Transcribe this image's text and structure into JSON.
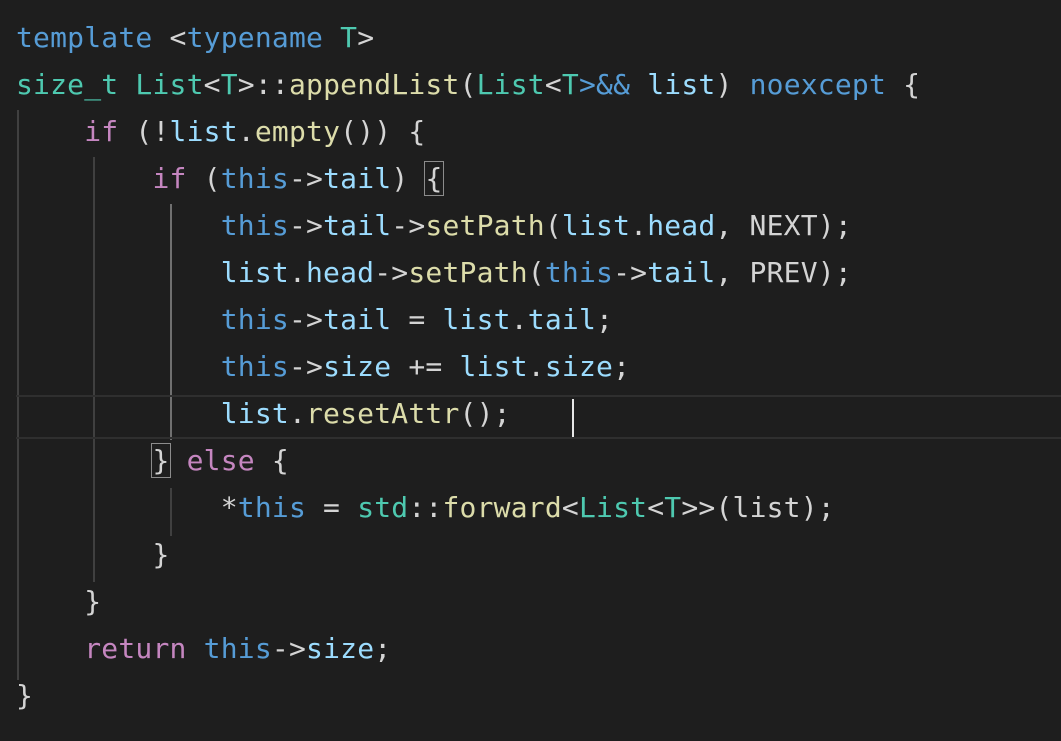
{
  "editor": {
    "background": "#1e1e1e",
    "colors": {
      "keyword": "#569cd6",
      "control": "#c586c0",
      "type": "#4ec9b0",
      "function": "#dcdcaa",
      "variable": "#9cdcfe",
      "plain": "#d4d4d4"
    },
    "lines": [
      [
        {
          "t": "template",
          "c": "kw"
        },
        {
          "t": " ",
          "c": "pl"
        },
        {
          "t": "<",
          "c": "op"
        },
        {
          "t": "typename",
          "c": "kw"
        },
        {
          "t": " ",
          "c": "pl"
        },
        {
          "t": "T",
          "c": "ty"
        },
        {
          "t": ">",
          "c": "op"
        }
      ],
      [
        {
          "t": "size_t",
          "c": "ty"
        },
        {
          "t": " ",
          "c": "pl"
        },
        {
          "t": "List",
          "c": "ty"
        },
        {
          "t": "<",
          "c": "op"
        },
        {
          "t": "T",
          "c": "ty"
        },
        {
          "t": ">::",
          "c": "op"
        },
        {
          "t": "appendList",
          "c": "fn"
        },
        {
          "t": "(",
          "c": "pl"
        },
        {
          "t": "List",
          "c": "ty"
        },
        {
          "t": "<",
          "c": "op"
        },
        {
          "t": "T",
          "c": "ty"
        },
        {
          "t": ">&&",
          "c": "kw"
        },
        {
          "t": " ",
          "c": "pl"
        },
        {
          "t": "list",
          "c": "var"
        },
        {
          "t": ")",
          "c": "pl"
        },
        {
          "t": " ",
          "c": "pl"
        },
        {
          "t": "noexcept",
          "c": "kw"
        },
        {
          "t": " ",
          "c": "pl"
        },
        {
          "t": "{",
          "c": "pl"
        }
      ],
      [
        {
          "t": "    ",
          "c": "pl"
        },
        {
          "t": "if",
          "c": "ctl"
        },
        {
          "t": " (",
          "c": "pl"
        },
        {
          "t": "!",
          "c": "op"
        },
        {
          "t": "list",
          "c": "var"
        },
        {
          "t": ".",
          "c": "pl"
        },
        {
          "t": "empty",
          "c": "fn"
        },
        {
          "t": "()) {",
          "c": "pl"
        }
      ],
      [
        {
          "t": "        ",
          "c": "pl"
        },
        {
          "t": "if",
          "c": "ctl"
        },
        {
          "t": " (",
          "c": "pl"
        },
        {
          "t": "this",
          "c": "kw"
        },
        {
          "t": "->",
          "c": "op"
        },
        {
          "t": "tail",
          "c": "var"
        },
        {
          "t": ") ",
          "c": "pl"
        },
        {
          "t": "{",
          "c": "pl",
          "box": true
        }
      ],
      [
        {
          "t": "            ",
          "c": "pl"
        },
        {
          "t": "this",
          "c": "kw"
        },
        {
          "t": "->",
          "c": "op"
        },
        {
          "t": "tail",
          "c": "var"
        },
        {
          "t": "->",
          "c": "op"
        },
        {
          "t": "setPath",
          "c": "fn"
        },
        {
          "t": "(",
          "c": "pl"
        },
        {
          "t": "list",
          "c": "var"
        },
        {
          "t": ".",
          "c": "pl"
        },
        {
          "t": "head",
          "c": "var"
        },
        {
          "t": ", NEXT);",
          "c": "pl"
        }
      ],
      [
        {
          "t": "            ",
          "c": "pl"
        },
        {
          "t": "list",
          "c": "var"
        },
        {
          "t": ".",
          "c": "pl"
        },
        {
          "t": "head",
          "c": "var"
        },
        {
          "t": "->",
          "c": "op"
        },
        {
          "t": "setPath",
          "c": "fn"
        },
        {
          "t": "(",
          "c": "pl"
        },
        {
          "t": "this",
          "c": "kw"
        },
        {
          "t": "->",
          "c": "op"
        },
        {
          "t": "tail",
          "c": "var"
        },
        {
          "t": ", PREV);",
          "c": "pl"
        }
      ],
      [
        {
          "t": "            ",
          "c": "pl"
        },
        {
          "t": "this",
          "c": "kw"
        },
        {
          "t": "->",
          "c": "op"
        },
        {
          "t": "tail",
          "c": "var"
        },
        {
          "t": " = ",
          "c": "op"
        },
        {
          "t": "list",
          "c": "var"
        },
        {
          "t": ".",
          "c": "pl"
        },
        {
          "t": "tail",
          "c": "var"
        },
        {
          "t": ";",
          "c": "pl"
        }
      ],
      [
        {
          "t": "            ",
          "c": "pl"
        },
        {
          "t": "this",
          "c": "kw"
        },
        {
          "t": "->",
          "c": "op"
        },
        {
          "t": "size",
          "c": "var"
        },
        {
          "t": " += ",
          "c": "op"
        },
        {
          "t": "list",
          "c": "var"
        },
        {
          "t": ".",
          "c": "pl"
        },
        {
          "t": "size",
          "c": "var"
        },
        {
          "t": ";",
          "c": "pl"
        }
      ],
      [
        {
          "t": "            ",
          "c": "pl"
        },
        {
          "t": "list",
          "c": "var"
        },
        {
          "t": ".",
          "c": "pl"
        },
        {
          "t": "resetAttr",
          "c": "fn"
        },
        {
          "t": "();",
          "c": "pl"
        }
      ],
      [
        {
          "t": "        ",
          "c": "pl"
        },
        {
          "t": "}",
          "c": "pl",
          "box": true
        },
        {
          "t": " ",
          "c": "pl"
        },
        {
          "t": "else",
          "c": "ctl"
        },
        {
          "t": " {",
          "c": "pl"
        }
      ],
      [
        {
          "t": "            ",
          "c": "pl"
        },
        {
          "t": "*",
          "c": "op"
        },
        {
          "t": "this",
          "c": "kw"
        },
        {
          "t": " = ",
          "c": "op"
        },
        {
          "t": "std",
          "c": "ty"
        },
        {
          "t": "::",
          "c": "pl"
        },
        {
          "t": "forward",
          "c": "fn"
        },
        {
          "t": "<",
          "c": "op"
        },
        {
          "t": "List",
          "c": "ty"
        },
        {
          "t": "<",
          "c": "op"
        },
        {
          "t": "T",
          "c": "ty"
        },
        {
          "t": ">>",
          "c": "op"
        },
        {
          "t": "(list);",
          "c": "pl"
        }
      ],
      [
        {
          "t": "        ",
          "c": "pl"
        },
        {
          "t": "}",
          "c": "pl"
        }
      ],
      [
        {
          "t": "    ",
          "c": "pl"
        },
        {
          "t": "}",
          "c": "pl"
        }
      ],
      [
        {
          "t": "    ",
          "c": "pl"
        },
        {
          "t": "return",
          "c": "ctl"
        },
        {
          "t": " ",
          "c": "pl"
        },
        {
          "t": "this",
          "c": "kw"
        },
        {
          "t": "->",
          "c": "op"
        },
        {
          "t": "size",
          "c": "var"
        },
        {
          "t": ";",
          "c": "pl"
        }
      ],
      [
        {
          "t": "}",
          "c": "pl"
        }
      ]
    ]
  }
}
